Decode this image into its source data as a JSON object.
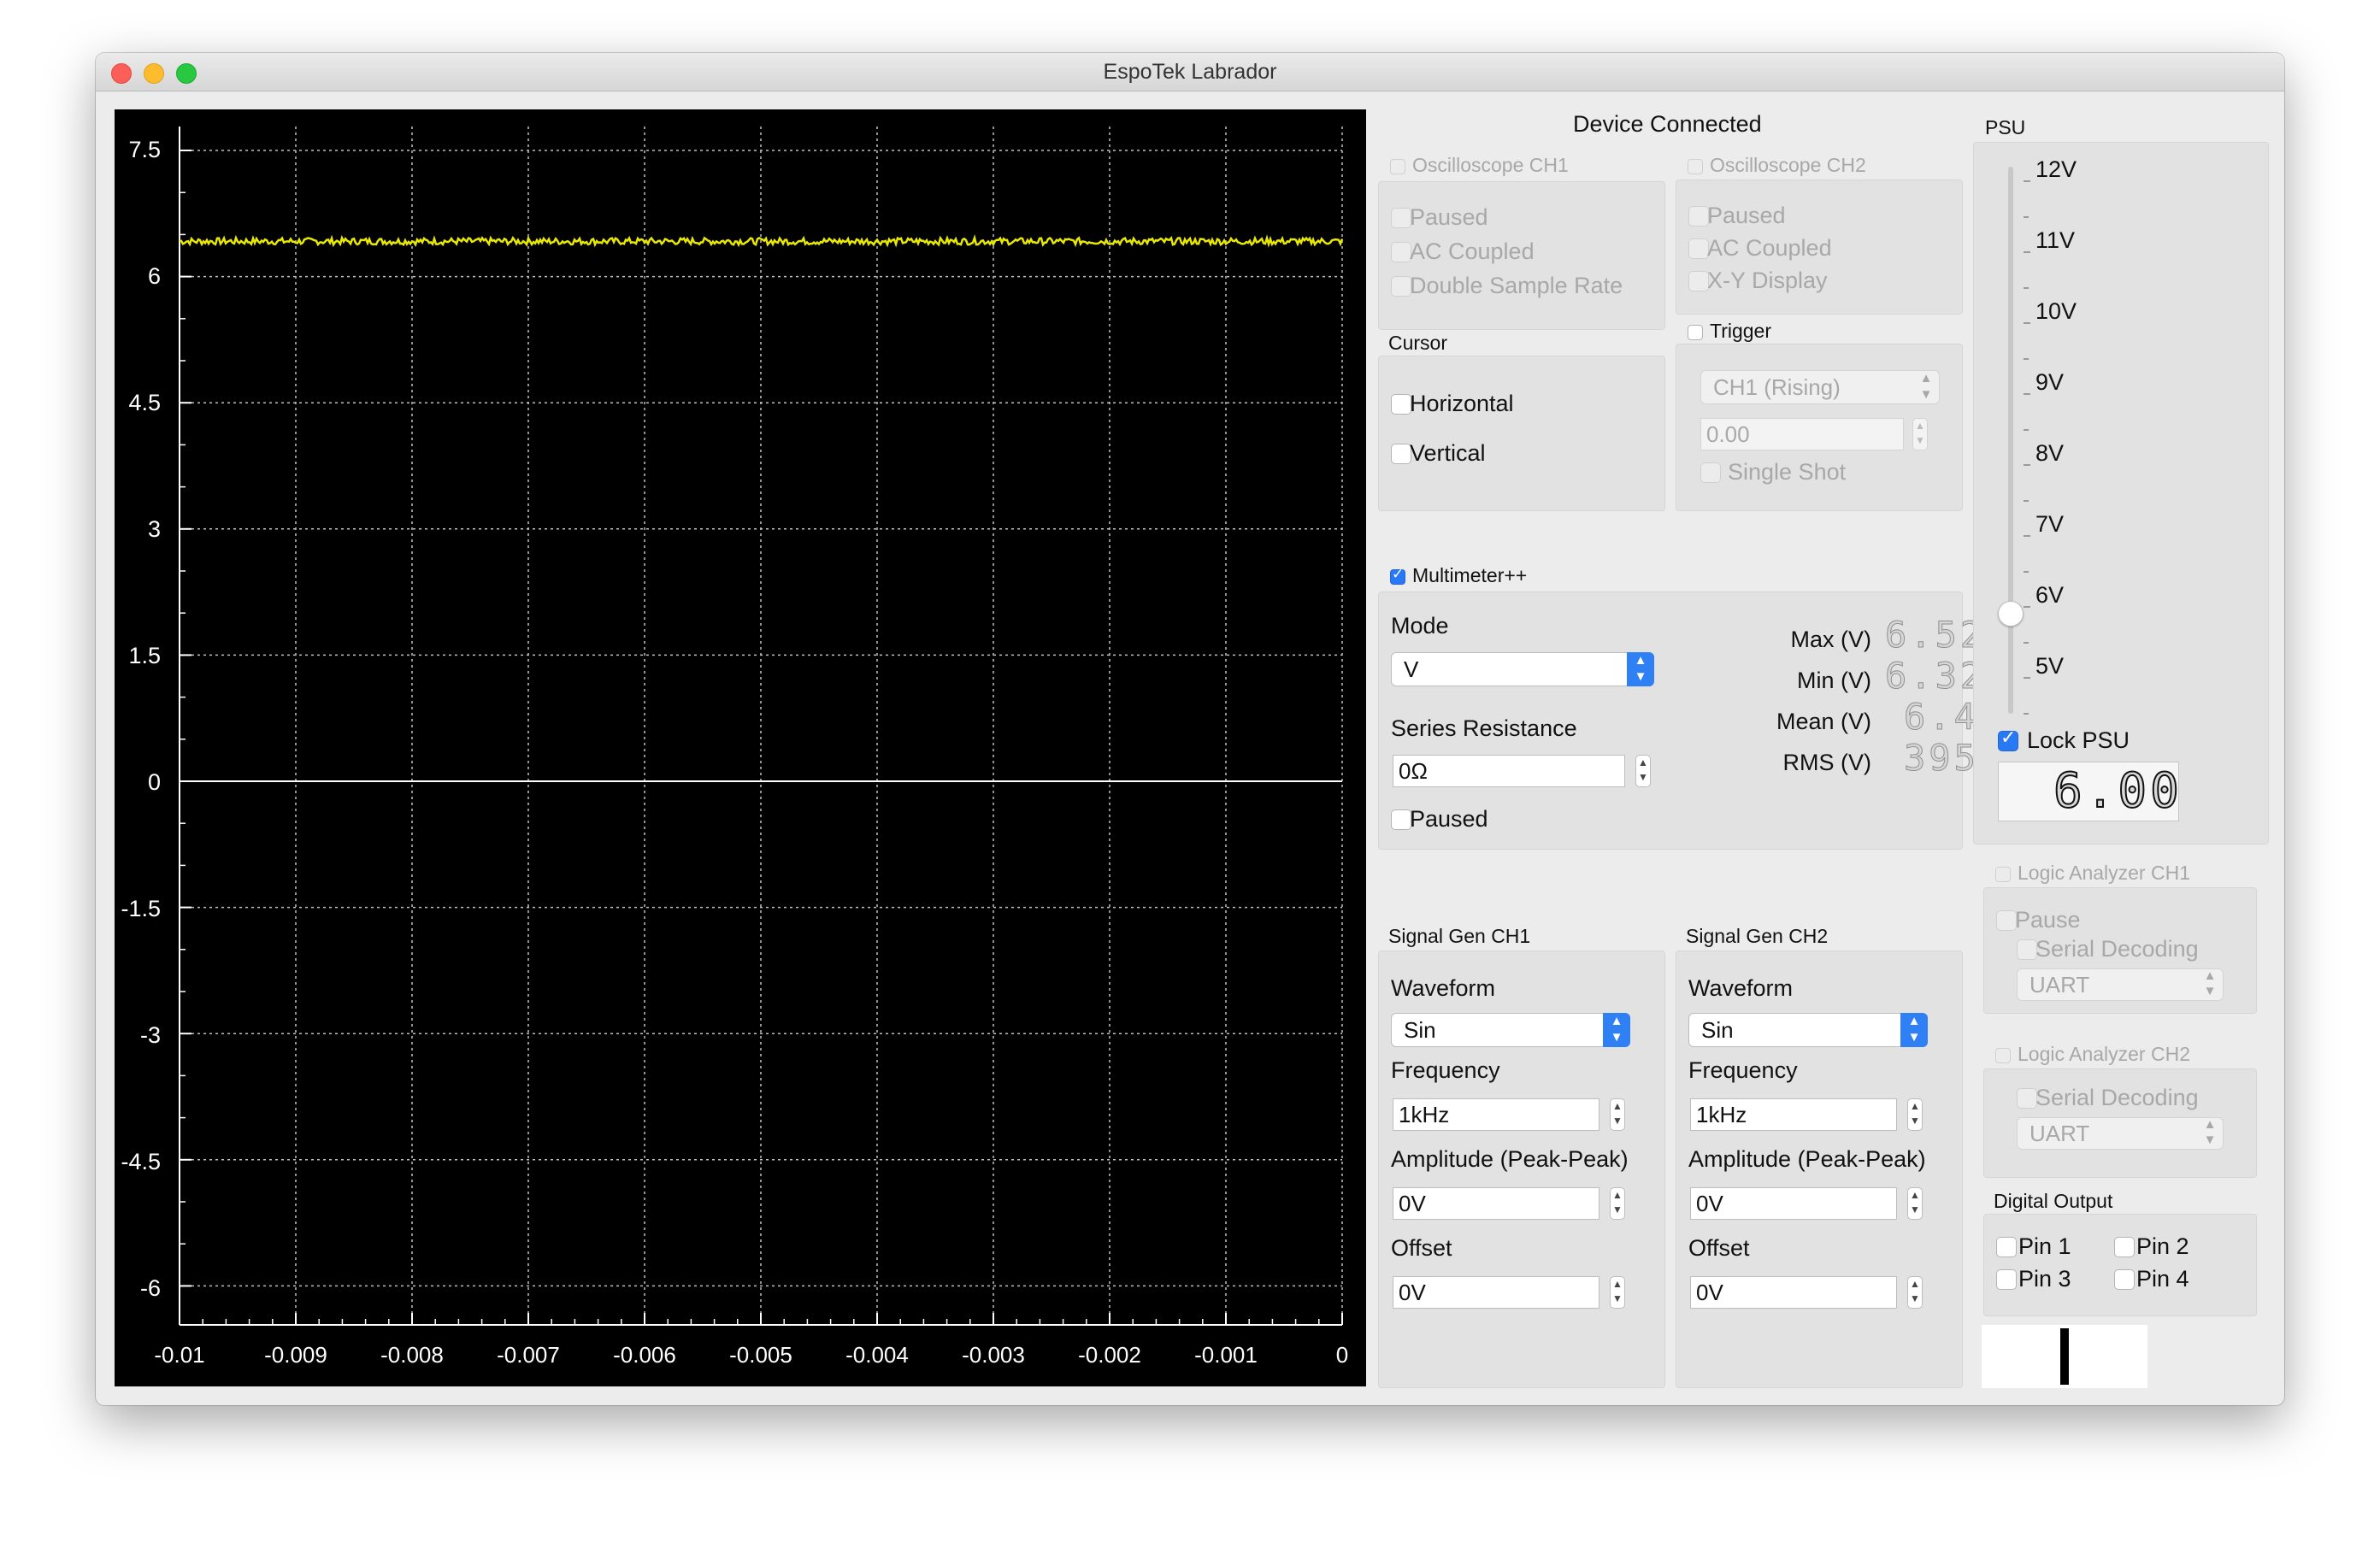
{
  "window": {
    "title": "EspoTek Labrador"
  },
  "scope": {
    "y_ticks": [
      "7.5",
      "6",
      "4.5",
      "3",
      "1.5",
      "0",
      "-1.5",
      "-3",
      "-4.5",
      "-6"
    ],
    "x_ticks": [
      "-0.01",
      "-0.009",
      "-0.008",
      "-0.007",
      "-0.006",
      "-0.005",
      "-0.004",
      "-0.003",
      "-0.002",
      "-0.001",
      "0"
    ],
    "trace_color": "#e8e800",
    "background": "#000000"
  },
  "chart_data": {
    "type": "line",
    "xlim": [
      -0.01,
      0
    ],
    "ylim": [
      -7,
      8
    ],
    "series": [
      {
        "x": [
          -0.01,
          0
        ],
        "values": [
          6.42,
          6.42
        ]
      }
    ]
  },
  "status": {
    "device": "Device Connected"
  },
  "osc_ch1": {
    "title": "Oscilloscope CH1",
    "paused": "Paused",
    "ac_coupled": "AC Coupled",
    "double_rate": "Double Sample Rate"
  },
  "osc_ch2": {
    "title": "Oscilloscope CH2",
    "paused": "Paused",
    "ac_coupled": "AC Coupled",
    "xy": "X-Y Display"
  },
  "cursor": {
    "title": "Cursor",
    "horizontal": "Horizontal",
    "vertical": "Vertical"
  },
  "trigger": {
    "title": "Trigger",
    "source": "CH1 (Rising)",
    "level": "0.00",
    "single_shot": "Single Shot"
  },
  "multimeter": {
    "title": "Multimeter++",
    "mode_label": "Mode",
    "mode_value": "V",
    "series_label": "Series Resistance",
    "series_value": "0Ω",
    "paused": "Paused",
    "max_label": "Max (V)",
    "max_value": "6.52",
    "min_label": "Min (V)",
    "min_value": "6.32",
    "mean_label": "Mean (V)",
    "mean_value": "6.4",
    "rms_label": "RMS (V)",
    "rms_value": "395"
  },
  "siggen1": {
    "title": "Signal Gen CH1",
    "waveform_label": "Waveform",
    "waveform_value": "Sin",
    "freq_label": "Frequency",
    "freq_value": "1kHz",
    "amp_label": "Amplitude (Peak-Peak)",
    "amp_value": "0V",
    "offset_label": "Offset",
    "offset_value": "0V"
  },
  "siggen2": {
    "title": "Signal Gen CH2",
    "waveform_label": "Waveform",
    "waveform_value": "Sin",
    "freq_label": "Frequency",
    "freq_value": "1kHz",
    "amp_label": "Amplitude (Peak-Peak)",
    "amp_value": "0V",
    "offset_label": "Offset",
    "offset_value": "0V"
  },
  "psu": {
    "title": "PSU",
    "ticks": [
      "12V",
      "11V",
      "10V",
      "9V",
      "8V",
      "7V",
      "6V",
      "5V"
    ],
    "lock_label": "Lock PSU",
    "display": "6.00",
    "level_volts": 6
  },
  "logic1": {
    "title": "Logic Analyzer CH1",
    "pause": "Pause",
    "serial": "Serial Decoding",
    "protocol": "UART"
  },
  "logic2": {
    "title": "Logic Analyzer CH2",
    "serial": "Serial Decoding",
    "protocol": "UART"
  },
  "digital": {
    "title": "Digital Output",
    "pin1": "Pin 1",
    "pin2": "Pin 2",
    "pin3": "Pin 3",
    "pin4": "Pin 4"
  }
}
